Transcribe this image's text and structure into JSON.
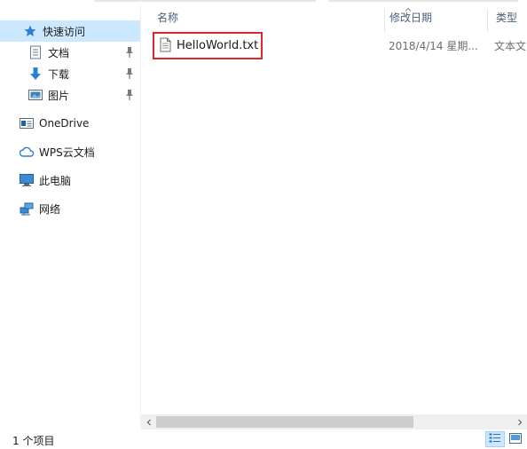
{
  "nav": {
    "quick_access": "快速访问",
    "documents": "文档",
    "downloads": "下载",
    "pictures": "图片",
    "onedrive": "OneDrive",
    "wps": "WPS云文档",
    "this_pc": "此电脑",
    "network": "网络"
  },
  "columns": {
    "name": "名称",
    "modified": "修改日期",
    "type": "类型"
  },
  "file": {
    "name": "HelloWorld.txt",
    "modified": "2018/4/14 星期...",
    "type": "文本文"
  },
  "status": {
    "item_count": "1 个项目"
  },
  "colors": {
    "selection": "#cce8ff",
    "highlight_box": "#e0262a",
    "header_text": "#4c607a"
  },
  "icons": {
    "quick_access": "star-icon",
    "documents": "document-icon",
    "downloads": "download-arrow-icon",
    "pictures": "picture-icon",
    "onedrive": "onedrive-icon",
    "wps": "cloud-icon",
    "this_pc": "computer-icon",
    "network": "network-icon",
    "file": "text-file-icon"
  }
}
